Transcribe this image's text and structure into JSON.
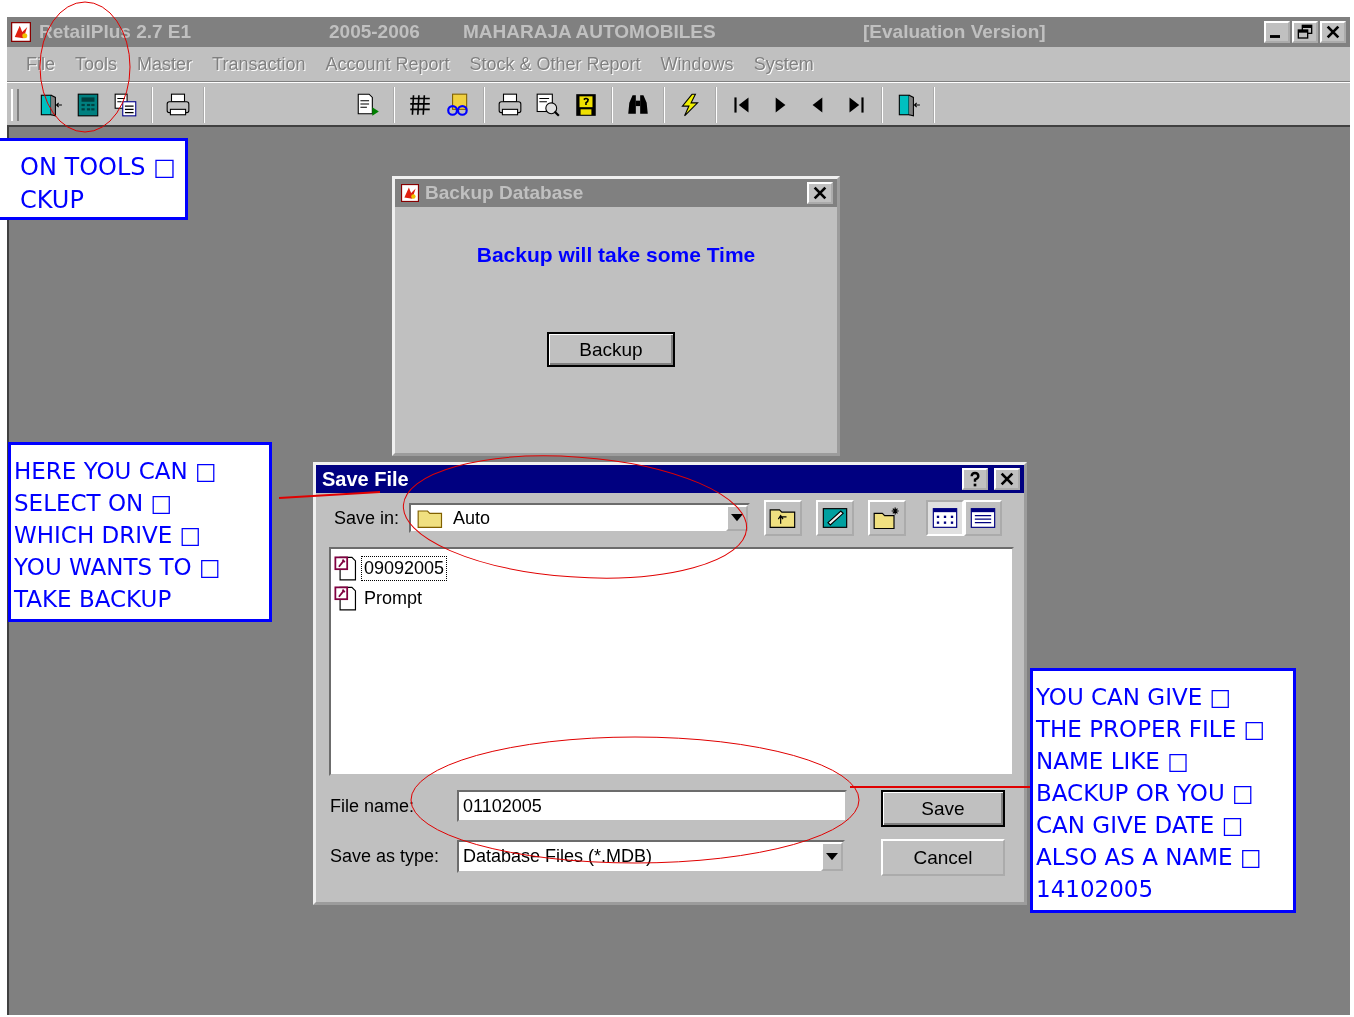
{
  "app_window": {
    "title_parts": [
      "RetailPlus 2.7 E1",
      "2005-2006",
      "MAHARAJA AUTOMOBILES",
      "[Evaluation Version]"
    ],
    "active": false
  },
  "menu": [
    {
      "label": "File",
      "disabled": true
    },
    {
      "label": "Tools",
      "disabled": true
    },
    {
      "label": "Master",
      "disabled": true
    },
    {
      "label": "Transaction",
      "disabled": true
    },
    {
      "label": "Account Report",
      "disabled": true
    },
    {
      "label": "Stock & Other Report",
      "disabled": true
    },
    {
      "label": "Windows",
      "disabled": true
    },
    {
      "label": "System",
      "disabled": true
    }
  ],
  "backup_dialog": {
    "title": "Backup Database",
    "active": false,
    "message": "Backup will take some Time",
    "button": "Backup"
  },
  "save_dialog": {
    "title": "Save File",
    "active": true,
    "save_in_label": "Save in:",
    "save_in_value": "Auto",
    "files": [
      {
        "name": "09092005",
        "selected": true
      },
      {
        "name": "Prompt",
        "selected": false
      }
    ],
    "file_name_label": "File name:",
    "file_name_value": "01102005",
    "type_label": "Save as type:",
    "type_value": "Database Files (*.MDB)",
    "buttons": [
      {
        "label": "Save",
        "default": true
      },
      {
        "label": "Cancel",
        "default": false
      }
    ]
  },
  "callouts": [
    {
      "text": "ON TOOLS □\nCKUP"
    },
    {
      "text": "HERE YOU CAN □\nSELECT ON □\nWHICH DRIVE □\nYOU WANTS TO □\nTAKE BACKUP"
    },
    {
      "text": "YOU CAN GIVE □\nTHE PROPER FILE □\nNAME LIKE □\nBACKUP OR YOU □\nCAN GIVE DATE □\nALSO AS A NAME □\n14102005"
    }
  ]
}
